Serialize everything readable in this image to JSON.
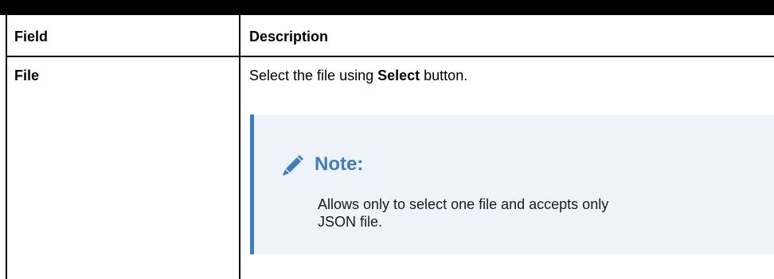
{
  "table": {
    "headers": {
      "field": "Field",
      "description": "Description"
    },
    "rows": [
      {
        "field": "File",
        "description_before": "Select the file using ",
        "description_bold": "Select",
        "description_after": " button.",
        "note": {
          "icon": "pencil-icon",
          "title": "Note:",
          "lines": [
            "Allows only to select one file and accepts only",
            "JSON file."
          ]
        }
      }
    ]
  },
  "colors": {
    "accent": "#3f7cc1",
    "note_background": "#edf3f8",
    "rule": "#000000"
  }
}
